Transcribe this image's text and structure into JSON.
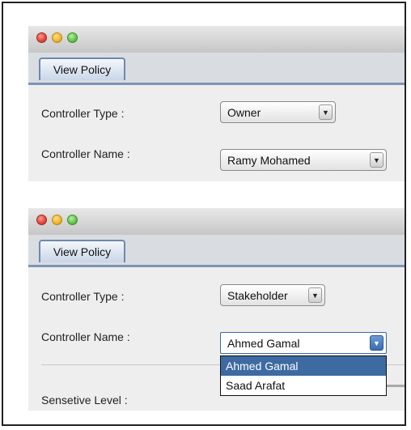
{
  "top_window": {
    "tab_label": "View Policy",
    "controller_type_label": "Controller Type :",
    "controller_type_value": "Owner",
    "controller_name_label": "Controller Name :",
    "controller_name_value": "Ramy Mohamed"
  },
  "bottom_window": {
    "tab_label": "View Policy",
    "controller_type_label": "Controller Type :",
    "controller_type_value": "Stakeholder",
    "controller_name_label": "Controller Name :",
    "controller_name_value": "Ahmed Gamal",
    "controller_name_options": [
      {
        "label": "Ahmed Gamal",
        "selected": true
      },
      {
        "label": "Saad Arafat",
        "selected": false
      }
    ],
    "sensitive_level_label": "Sensetive Level :"
  },
  "icons": {
    "close": "red-close-light-icon",
    "minimize": "yellow-minimize-light-icon",
    "zoom": "green-zoom-light-icon",
    "dropdown": "chevron-down-icon"
  },
  "colors": {
    "tab_border": "#6f89ad",
    "selection": "#3e6aa2",
    "close": "#e0443a",
    "minimize": "#f0b22a",
    "zoom": "#5ec24a"
  }
}
